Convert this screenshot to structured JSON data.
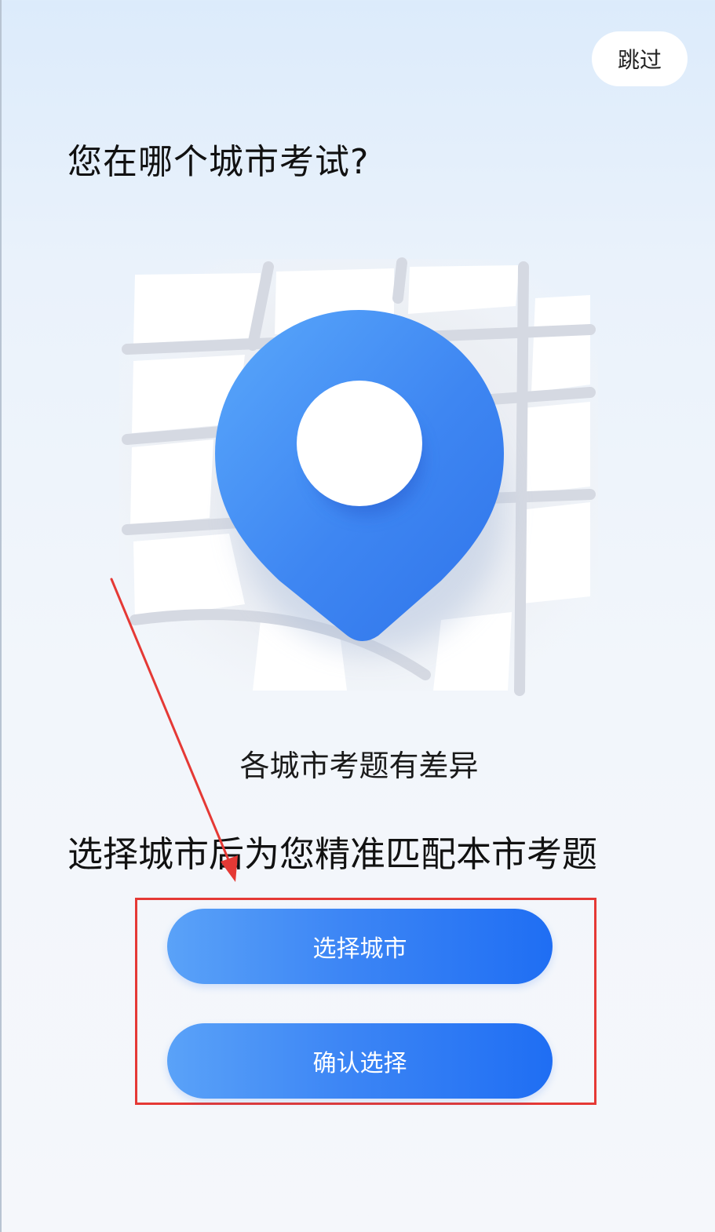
{
  "header": {
    "skip_label": "跳过"
  },
  "main": {
    "title": "您在哪个城市考试?",
    "subtitle": "各城市考题有差异",
    "description": "选择城市后为您精准匹配本市考题"
  },
  "actions": {
    "select_city_label": "选择城市",
    "confirm_label": "确认选择"
  },
  "illustration": {
    "icon": "map-pin-icon",
    "pin_color": "#3f86f3"
  },
  "annotation": {
    "color": "#e53935"
  }
}
